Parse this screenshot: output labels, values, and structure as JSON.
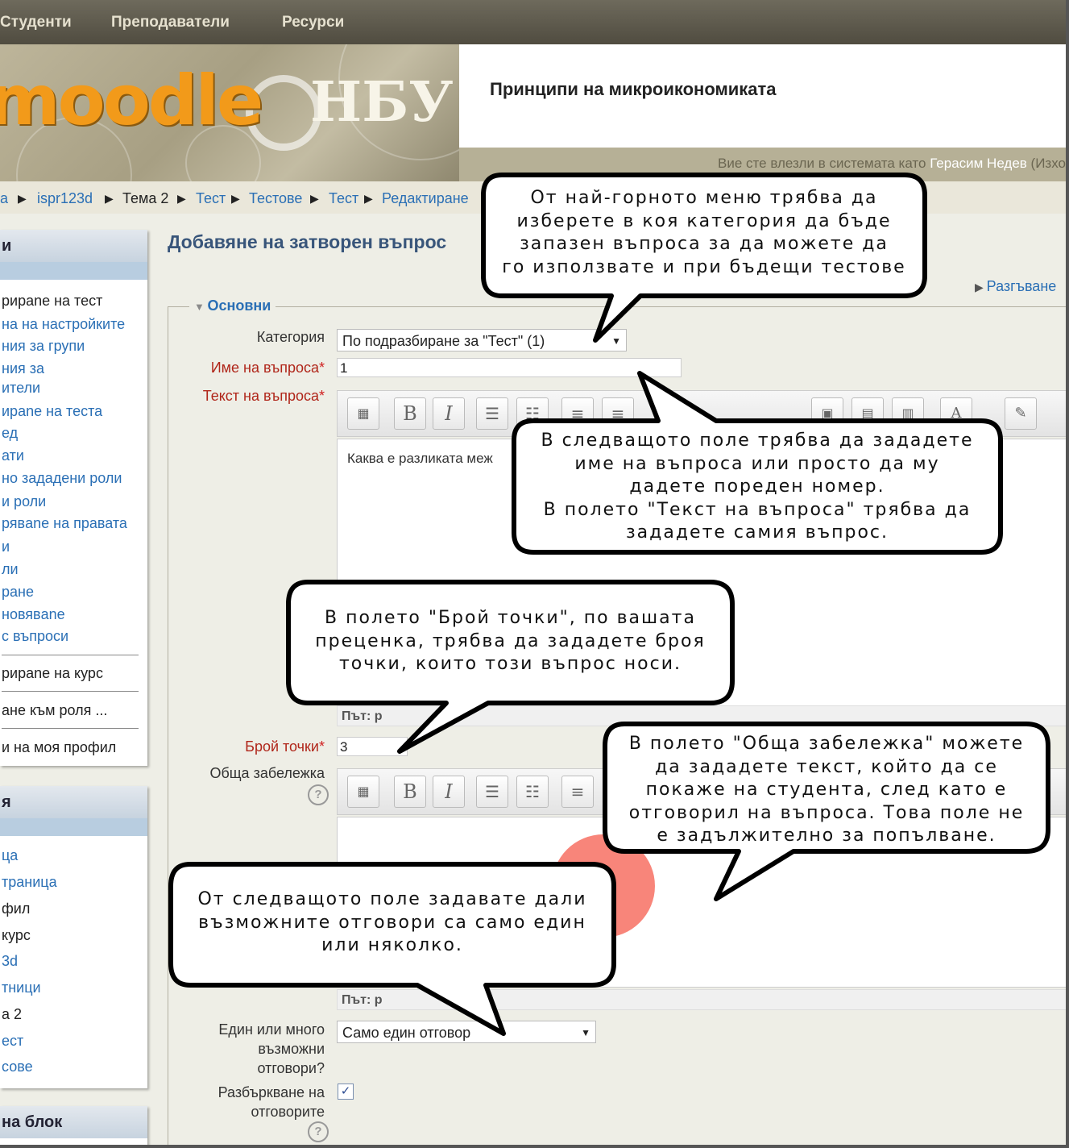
{
  "topnav": {
    "items": [
      "Студенти",
      "Преподаватели",
      "Ресурси"
    ]
  },
  "header": {
    "logo_moodle": "moodle",
    "logo_nbu": "НБУ",
    "course_title": "Принципи на микроикономиката",
    "login_prefix": "Вие сте влезли в системата като ",
    "login_user": "Герасим Недев",
    "login_suffix": " (Изхо"
  },
  "breadcrumb": [
    "а",
    "ispr123d",
    "Тема 2",
    "Тест",
    "Тестове",
    "Тест",
    "Редактиране"
  ],
  "sidebar": {
    "block1_title": "и",
    "block1_links": [
      "рирane на тест",
      "на на настройките",
      "ния за групи",
      "ния за",
      "ители",
      "ирane на теста",
      "ед",
      "ати",
      "но зададени роли",
      "и роли",
      "рявane на правата",
      "и",
      "ли",
      "ране",
      "новявane",
      "с въпроси"
    ],
    "block1_extra": [
      "рирane на курс",
      "ане към роля ...",
      "и на моя профил"
    ],
    "block2_title": "я",
    "block2_items": [
      "ца",
      "траница",
      "фил",
      "курс",
      "3d",
      "тници",
      "а 2",
      "ест",
      "сове"
    ],
    "block3_title": "на блок"
  },
  "main": {
    "page_title": "Добавяне на затворен въпрос",
    "expand_link": "Разгъване",
    "legend": "Основни",
    "category_label": "Категория",
    "category_value": "По подразбиране за \"Тест\" (1)",
    "question_name_label": "Име на въпроса",
    "question_name_value": "1",
    "question_text_label": "Текст на въпроса",
    "question_text_value": "Каква е разликата меж",
    "path1": "Път: p",
    "points_label": "Брой точки",
    "points_value": "3",
    "general_feedback_label": "Обща забележка",
    "path2": "Път: p",
    "single_label_1": "Един или много",
    "single_label_2": "възможни",
    "single_label_3": "отговори?",
    "single_value": "Само един отговор",
    "shuffle_label_1": "Разбъркване на",
    "shuffle_label_2": "отговорите",
    "required_star": "*",
    "help_glyph": "?",
    "toolbar_bold": "B",
    "toolbar_italic": "I"
  },
  "callouts": {
    "c1": [
      "От най-горното меню трябва да",
      "изберете в коя категория да бъде",
      "запазен въпроса за да можете да",
      "го използвате и при бъдещи тестове"
    ],
    "c2": [
      "В следващото поле трябва да зададете",
      "име на въпроса или просто да му",
      "дадете пореден номер.",
      "В полето \"Текст на въпроса\" трябва да",
      "зададете самия въпрос."
    ],
    "c3": [
      "В полето \"Брой точки\", по вашата",
      "преценка, трябва да зададете броя",
      "точки, които този въпрос носи."
    ],
    "c4": [
      "В полето \"Обща забележка\" можете",
      "да зададете текст, който да се",
      "покаже на студента, след като е",
      "отговорил на въпроса. Това поле не",
      "е задължително за попълване."
    ],
    "c5": [
      "От следващото поле задавате дали",
      "възможните отговори са само един",
      "или няколко."
    ]
  },
  "colors": {
    "link": "#2a6fb5",
    "title": "#38557a",
    "required": "#b0261a",
    "logo_orange": "#f29a1a",
    "highlight": "#f8857a"
  }
}
